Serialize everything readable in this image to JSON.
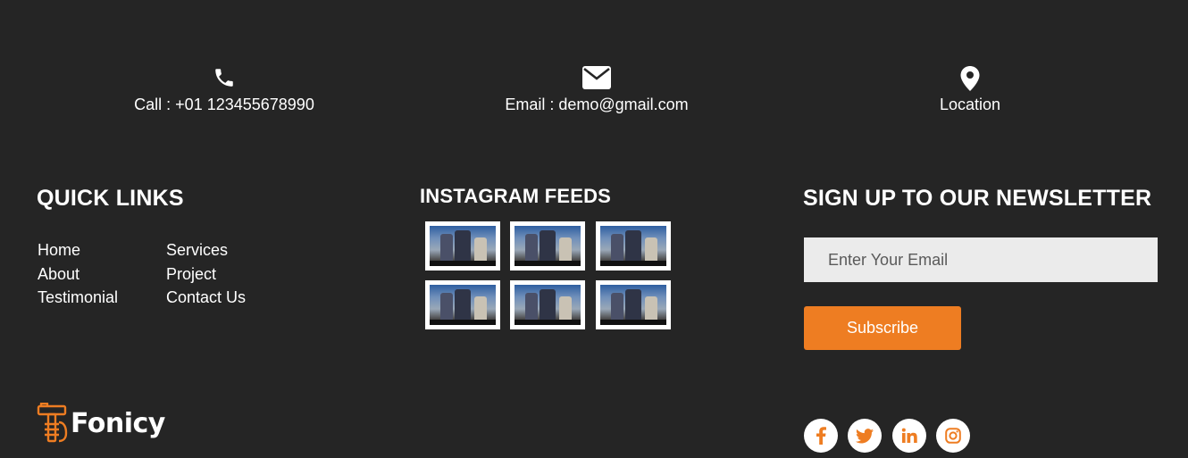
{
  "contact": {
    "phone": {
      "icon": "phone-icon",
      "text": "Call : +01 123455678990"
    },
    "email": {
      "icon": "envelope-icon",
      "text": "Email : demo@gmail.com"
    },
    "location": {
      "icon": "map-pin-icon",
      "text": "Location"
    }
  },
  "quick_links": {
    "title": "QUICK LINKS",
    "col1": [
      "Home",
      "About",
      "Testimonial"
    ],
    "col2": [
      "Services",
      "Project",
      "Contact Us"
    ]
  },
  "instagram": {
    "title": "INSTAGRAM FEEDS",
    "thumbnails": 6
  },
  "newsletter": {
    "title": "SIGN UP TO OUR NEWSLETTER",
    "email_placeholder": "Enter Your Email",
    "email_value": "",
    "subscribe_label": "Subscribe"
  },
  "brand": {
    "logo_text": "Fonicy",
    "accent_color": "#ee7d22",
    "background_color": "#252525"
  },
  "social": [
    "facebook-icon",
    "twitter-icon",
    "linkedin-icon",
    "instagram-icon"
  ]
}
